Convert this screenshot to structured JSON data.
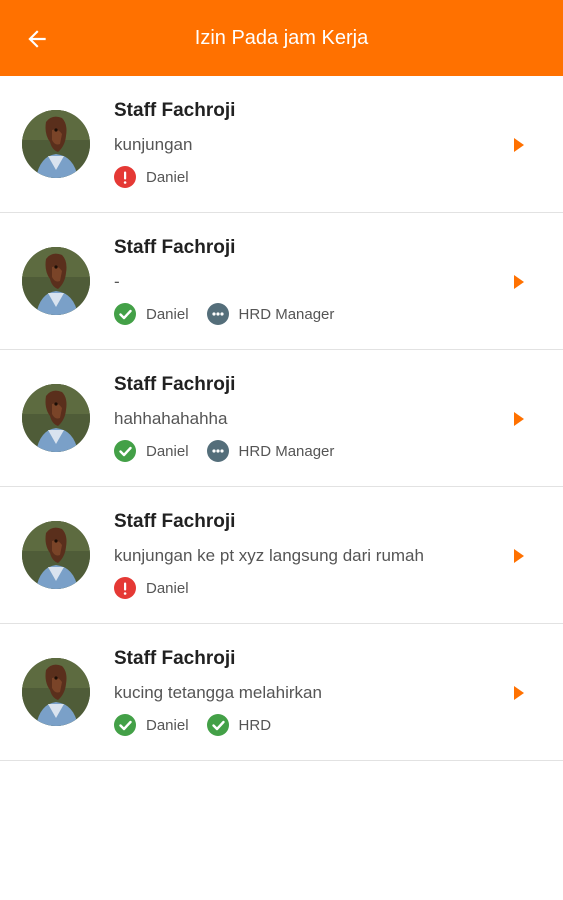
{
  "app": {
    "title": "Izin Pada jam Kerja",
    "accent": "#ff7100"
  },
  "status_colors": {
    "approved": "#43a047",
    "rejected": "#e53935",
    "pending": "#546e7a"
  },
  "items": [
    {
      "name": "Staff Fachroji",
      "description": "kunjungan",
      "approvals": [
        {
          "approver": "Daniel",
          "status": "rejected",
          "icon": "error-icon"
        }
      ]
    },
    {
      "name": "Staff Fachroji",
      "description": "-",
      "approvals": [
        {
          "approver": "Daniel",
          "status": "approved",
          "icon": "check-circle-icon"
        },
        {
          "approver": "HRD Manager",
          "status": "pending",
          "icon": "more-horiz-icon"
        }
      ]
    },
    {
      "name": "Staff Fachroji",
      "description": "hahhahahahha",
      "approvals": [
        {
          "approver": "Daniel",
          "status": "approved",
          "icon": "check-circle-icon"
        },
        {
          "approver": "HRD Manager",
          "status": "pending",
          "icon": "more-horiz-icon"
        }
      ]
    },
    {
      "name": "Staff Fachroji",
      "description": "kunjungan ke pt xyz langsung dari rumah",
      "approvals": [
        {
          "approver": "Daniel",
          "status": "rejected",
          "icon": "error-icon"
        }
      ]
    },
    {
      "name": "Staff Fachroji",
      "description": "kucing tetangga melahirkan",
      "approvals": [
        {
          "approver": "Daniel",
          "status": "approved",
          "icon": "check-circle-icon"
        },
        {
          "approver": "HRD",
          "status": "approved",
          "icon": "check-circle-icon"
        }
      ]
    }
  ]
}
